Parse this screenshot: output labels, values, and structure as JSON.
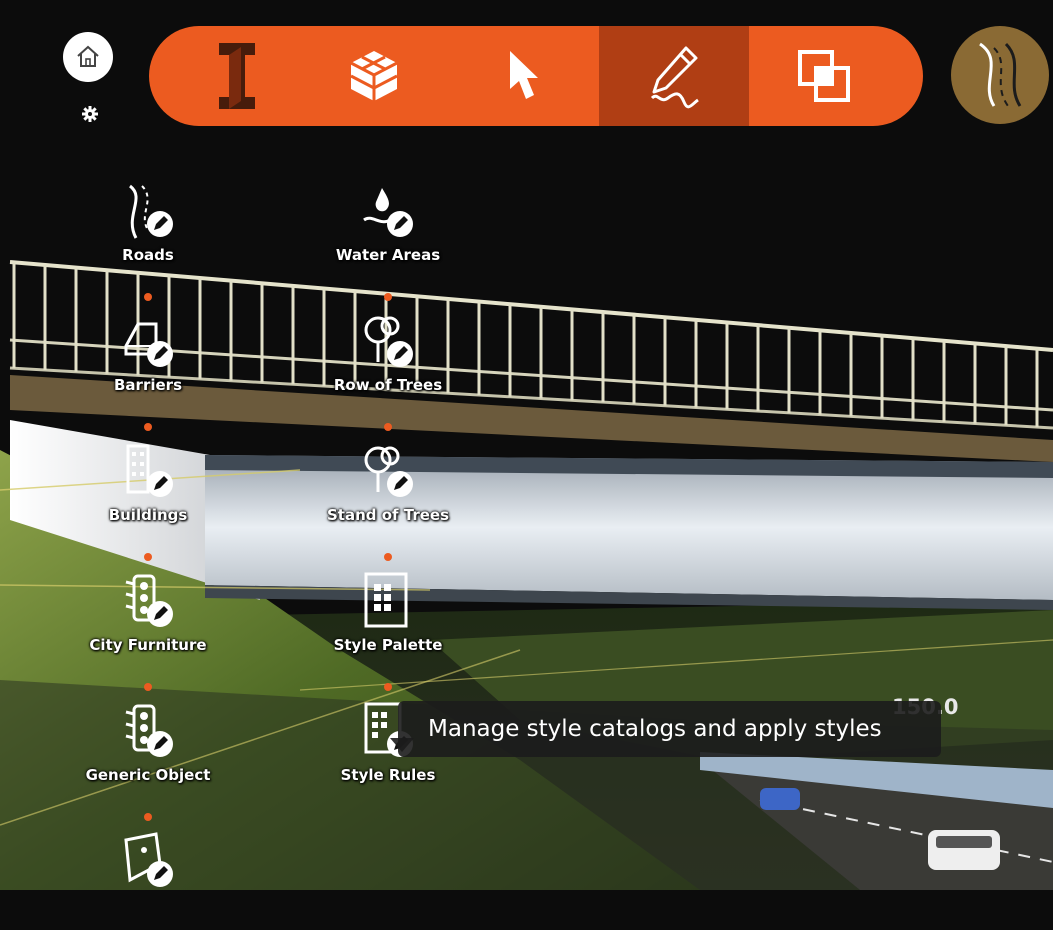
{
  "top_left": {
    "home_icon": "home-icon",
    "settings_icon": "gear-icon"
  },
  "toolbar": {
    "buttons": [
      {
        "name": "infraworks-logo",
        "icon": "infraworks-logo-icon"
      },
      {
        "name": "model-components",
        "icon": "cube-icon"
      },
      {
        "name": "select",
        "icon": "cursor-icon"
      },
      {
        "name": "create-sketch",
        "icon": "pencil-icon",
        "active": true
      },
      {
        "name": "overlay",
        "icon": "overlap-squares-icon"
      }
    ],
    "accent_color": "#ec5b20",
    "active_color": "#b03e14"
  },
  "road_button": {
    "icon": "road-icon",
    "color": "#8a6a34"
  },
  "menu": {
    "left": [
      {
        "label": "Roads",
        "icon": "road-edit-icon"
      },
      {
        "label": "Barriers",
        "icon": "barrier-edit-icon"
      },
      {
        "label": "Buildings",
        "icon": "building-edit-icon"
      },
      {
        "label": "City Furniture",
        "icon": "traffic-light-edit-icon"
      },
      {
        "label": "Generic Object",
        "icon": "generic-object-edit-icon"
      },
      {
        "label": "",
        "icon": "area-edit-icon"
      }
    ],
    "right": [
      {
        "label": "Water Areas",
        "icon": "water-edit-icon"
      },
      {
        "label": "Row of Trees",
        "icon": "tree-row-edit-icon"
      },
      {
        "label": "Stand of Trees",
        "icon": "tree-stand-edit-icon"
      },
      {
        "label": "Style Palette",
        "icon": "style-palette-icon"
      },
      {
        "label": "Style Rules",
        "icon": "style-rules-icon"
      }
    ]
  },
  "tooltip": {
    "text": "Manage style catalogs and apply styles"
  },
  "scene": {
    "distance_label": "150.0"
  }
}
